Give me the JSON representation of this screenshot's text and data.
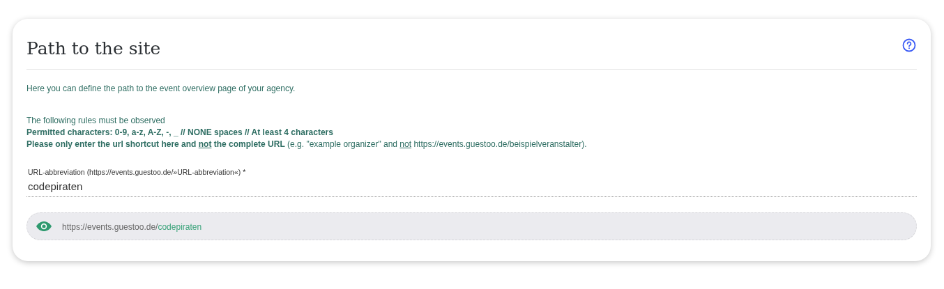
{
  "card": {
    "title": "Path to the site"
  },
  "intro": "Here you can define the path to the event overview page of your agency.",
  "rules": {
    "heading": "The following rules must be observed",
    "lines": [
      [
        {
          "text": "Permitted characters: 0-9, a-z, A-Z, -, _ // NONE spaces // At least 4 characters",
          "bold": true,
          "underline": false
        }
      ],
      [
        {
          "text": "Please only enter the url shortcut here and ",
          "bold": true,
          "underline": false
        },
        {
          "text": "not",
          "bold": true,
          "underline": true
        },
        {
          "text": " the complete URL",
          "bold": true,
          "underline": false
        },
        {
          "text": " (e.g. \"example organizer\" and ",
          "bold": false,
          "underline": false
        },
        {
          "text": "not",
          "bold": false,
          "underline": true
        },
        {
          "text": " https://events.guestoo.de/beispielveranstalter).",
          "bold": false,
          "underline": false
        }
      ]
    ]
  },
  "field": {
    "label": "URL-abbreviation (https://events.guestoo.de/»URL-abbreviation«) *",
    "value": "codepiraten"
  },
  "preview": {
    "base": "https://events.guestoo.de/",
    "slug": "codepiraten"
  }
}
